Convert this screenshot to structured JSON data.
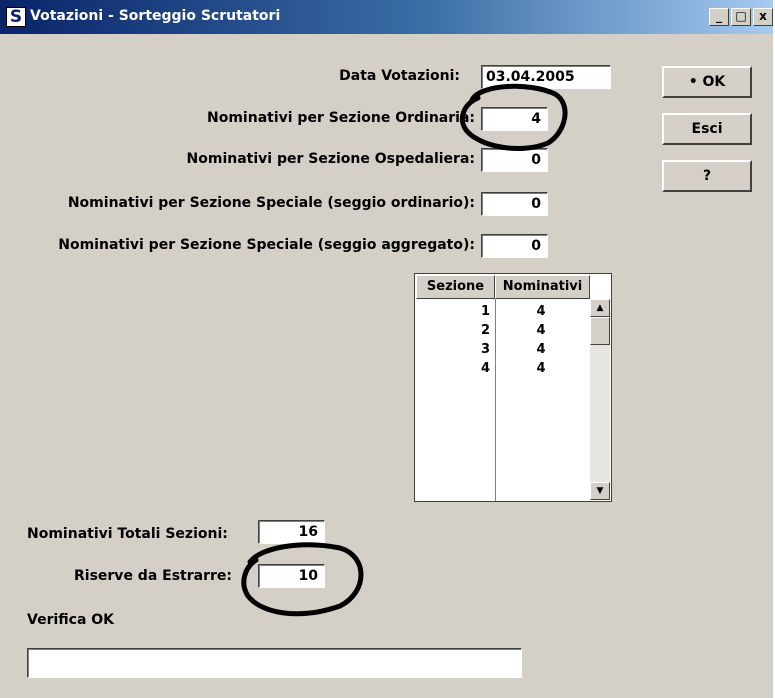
{
  "window": {
    "title": "Votazioni - Sorteggio Scrutatori",
    "app_icon": "S",
    "controls": {
      "minimize": "_",
      "maximize": "□",
      "close": "x"
    }
  },
  "form": {
    "data_votazioni": {
      "label": "Data Votazioni:",
      "value": "03.04.2005"
    },
    "ordinaria": {
      "label": "Nominativi per Sezione Ordinaria:",
      "value": "4"
    },
    "ospedaliera": {
      "label": "Nominativi per Sezione Ospedaliera:",
      "value": "0"
    },
    "speciale_ordinario": {
      "label": "Nominativi per Sezione Speciale (seggio ordinario):",
      "value": "0"
    },
    "speciale_aggregato": {
      "label": "Nominativi per Sezione Speciale (seggio aggregato):",
      "value": "0"
    },
    "totali": {
      "label": "Nominativi Totali Sezioni:",
      "value": "16"
    },
    "riserve": {
      "label": "Riserve da Estrarre:",
      "value": "10"
    },
    "verifica": {
      "label": "Verifica OK",
      "value": ""
    }
  },
  "buttons": {
    "ok": "• OK",
    "esci": "Esci",
    "help": "?"
  },
  "grid": {
    "headers": [
      "Sezione",
      "Nominativi"
    ],
    "rows": [
      {
        "sezione": "1",
        "nominativi": "4"
      },
      {
        "sezione": "2",
        "nominativi": "4"
      },
      {
        "sezione": "3",
        "nominativi": "4"
      },
      {
        "sezione": "4",
        "nominativi": "4"
      }
    ]
  },
  "colors": {
    "face": "#d4d0c8",
    "title_start": "#0a246a",
    "title_end": "#a6caf0",
    "annotation": "#000000"
  }
}
